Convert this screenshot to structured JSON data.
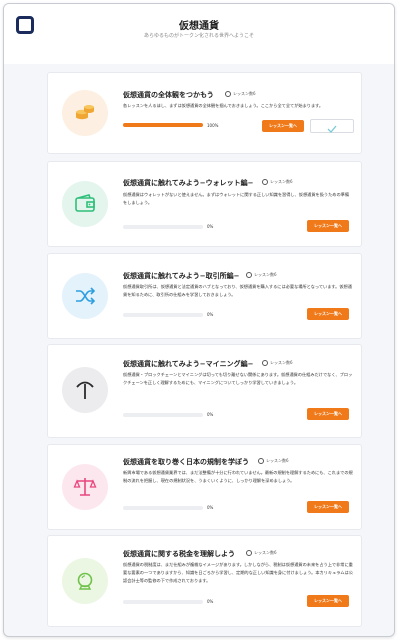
{
  "header": {
    "title": "仮想通貨",
    "subtitle": "あらゆるものがトークン化される世界へようこそ"
  },
  "courses": [
    {
      "title": "仮想通貨の全体観をつかもう",
      "badge": "レッスン数6",
      "description": "各レッスンを人るほし、まずは仮想通貨の全体観を掴んでおきましょう。ここから全て全てが始まります。",
      "progress_label": "100%",
      "progress": 1.0,
      "button_label": "レッスン一覧へ",
      "completed": true,
      "icon": "coins-icon",
      "icon_bg": "#fdf0e2",
      "icon_color": "#f0a632"
    },
    {
      "title": "仮想通貨に触れてみよう−ウォレット編−",
      "badge": "レッスン数6",
      "description": "仮想通貨はウォレットがないと使えません。まずはウォレットに関する正しい知識を習得し、仮想通貨を扱うための準備をしましょう。",
      "progress_label": "0%",
      "progress": 0.0,
      "button_label": "レッスン一覧へ",
      "completed": false,
      "icon": "wallet-icon",
      "icon_bg": "#e3f5ec",
      "icon_color": "#2fbf7a"
    },
    {
      "title": "仮想通貨に触れてみよう−取引所編−",
      "badge": "レッスン数6",
      "description": "仮想通貨取引所は、仮想通貨と法定通貨のハブとなっており、仮想通貨を購入するには必要な場所となっています。仮想通貨を知るために、取引所の仕組みを学習しておきましょう。",
      "progress_label": "0%",
      "progress": 0.0,
      "button_label": "レッスン一覧へ",
      "completed": false,
      "icon": "shuffle-icon",
      "icon_bg": "#e4f2fb",
      "icon_color": "#2d9fe0"
    },
    {
      "title": "仮想通貨に触れてみよう−マイニング編−",
      "badge": "レッスン数6",
      "description": "仮想通貨・ブロックチェーンとマイニングは切っても切り離せない関係にあります。仮想通貨の仕組みだけでなく、ブロックチェーンを正しく理解するためにも、マイニングについてしっかり学習していきましょう。",
      "progress_label": "0%",
      "progress": 0.0,
      "button_label": "レッスン一覧へ",
      "completed": false,
      "icon": "pickaxe-icon",
      "icon_bg": "#ececef",
      "icon_color": "#2b2b2e"
    },
    {
      "title": "仮想通貨を取り巻く日本の規制を学ぼう",
      "badge": "レッスン数6",
      "description": "新興市場である仮想通貨業界では、まだ法整備が十分に行われていません。最新の規制を理解するためにも、これまでの規制の流れを把握し、現在の規制状況を、うまくいくように、しっかり理解を深めましょう。",
      "progress_label": "0%",
      "progress": 0.0,
      "button_label": "レッスン一覧へ",
      "completed": false,
      "icon": "scale-icon",
      "icon_bg": "#fde7ef",
      "icon_color": "#e8467e"
    },
    {
      "title": "仮想通貨に関する税金を理解しよう",
      "badge": "レッスン数6",
      "description": "仮想通貨の税制度は、まだ仕組みが複雑なイメージがあります。しかしながら、税制は仮想通貨の未来を占う上で非常に重要な要素の一つでありますから、知識を日ごろから学習し、定期的な正しい知識を身に付けましょう。本カリキュラムは公認会計士等の監修の下で作成されております。",
      "progress_label": "0%",
      "progress": 0.0,
      "button_label": "レッスン一覧へ",
      "completed": false,
      "icon": "crystal-ball-icon",
      "icon_bg": "#ebf7e3",
      "icon_color": "#6fc24a"
    }
  ],
  "colors": {
    "accent": "#f07a1a",
    "brand": "#1b2b5c"
  }
}
